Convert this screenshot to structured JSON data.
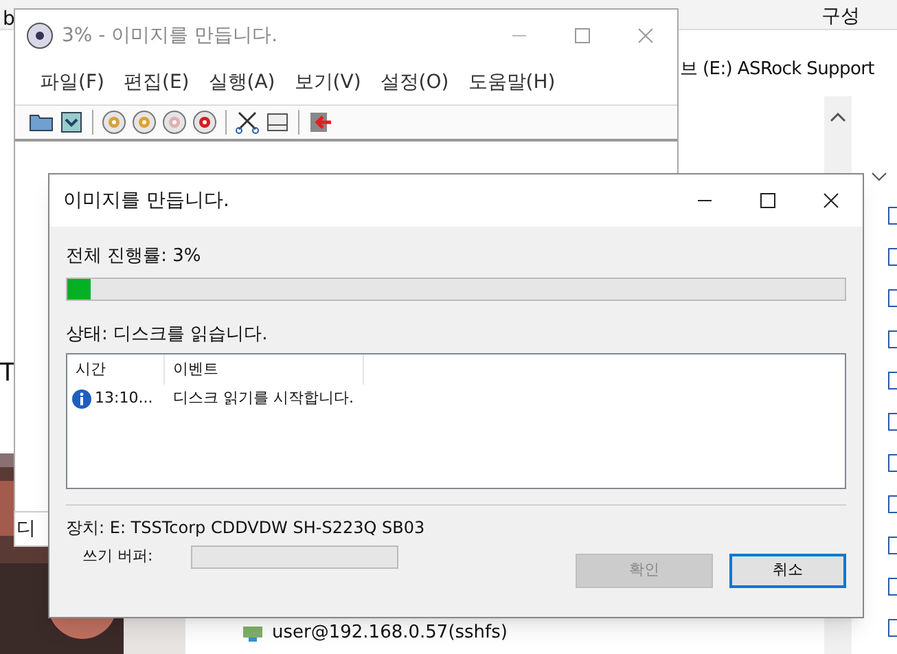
{
  "explorer": {
    "fragments": [
      "b",
      "T",
      "디"
    ],
    "column_header": "구성",
    "address": "브 (E:) ASRock Support",
    "items": [
      {
        "label": "user@192.168.0.57(sshfs)"
      }
    ]
  },
  "main_window": {
    "title": "3% - 이미지를 만듭니다.",
    "active": false,
    "menu": [
      "파일(F)",
      "편집(E)",
      "실행(A)",
      "보기(V)",
      "설정(O)",
      "도움말(H)"
    ]
  },
  "dialog": {
    "title": "이미지를 만듭니다.",
    "progress_label": "전체 진행률: 3%",
    "progress": {
      "level": 0.03
    },
    "status": "상태: 디스크를 읽습니다.",
    "log": {
      "columns": [
        "시간",
        "이벤트"
      ],
      "rows": [
        {
          "kind": "info",
          "time": "13:10...",
          "event": "디스크 읽기를 시작합니다."
        }
      ]
    },
    "device": "장치: E: TSSTcorp CDDVDW SH-S223Q SB03",
    "buffer_label": "쓰기 버퍼:",
    "buttons": [
      {
        "label": "확인",
        "disabled": true,
        "default": false
      },
      {
        "label": "취소",
        "disabled": false,
        "default": true
      }
    ]
  }
}
